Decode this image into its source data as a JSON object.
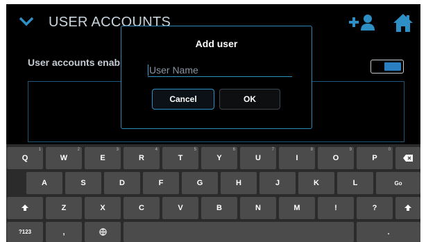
{
  "header": {
    "title": "USER ACCOUNTS",
    "menu_icon": "chevron-down-icon",
    "add_user_icon": "add-user-icon",
    "home_icon": "home-icon"
  },
  "settings": {
    "accounts_label": "User accounts enab",
    "toggle_on": true
  },
  "dialog": {
    "title": "Add user",
    "username_placeholder": "User Name",
    "username_value": "",
    "cancel_label": "Cancel",
    "ok_label": "OK"
  },
  "keyboard": {
    "row1": [
      [
        "Q",
        "1"
      ],
      [
        "W",
        "2"
      ],
      [
        "E",
        "3"
      ],
      [
        "R",
        "4"
      ],
      [
        "T",
        "5"
      ],
      [
        "Y",
        "6"
      ],
      [
        "U",
        "7"
      ],
      [
        "I",
        "8"
      ],
      [
        "O",
        "9"
      ],
      [
        "P",
        "0"
      ]
    ],
    "row2": [
      "A",
      "S",
      "D",
      "F",
      "G",
      "H",
      "J",
      "K",
      "L"
    ],
    "row3": [
      "Z",
      "X",
      "C",
      "V",
      "B",
      "N",
      "M",
      "!",
      "?"
    ],
    "go_label": "Go",
    "symbols_label": "?123",
    "comma_label": ",",
    "period_label": ".",
    "backspace_icon": "backspace-icon",
    "shift_icon": "shift-icon",
    "globe_icon": "globe-icon"
  },
  "colors": {
    "accent": "#2e8fc4",
    "toggle_knob": "#2a7fc2",
    "background": "#000000",
    "keyboard_bg": "#2b2b2b",
    "key_bg": "#4b4b4b"
  }
}
